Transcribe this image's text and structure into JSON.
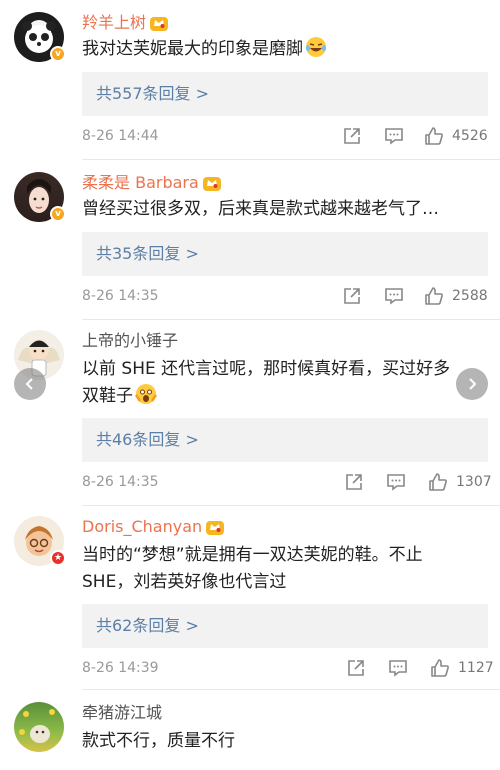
{
  "comments": [
    {
      "username": "羚羊上树",
      "text": "我对达芙妮最大的印象是磨脚",
      "replies_label": "共557条回复 >",
      "time": "8-26 14:44",
      "likes": "4526"
    },
    {
      "username": "柔柔是 Barbara",
      "text": "曾经买过很多双，后来真是款式越来越老气了…",
      "replies_label": "共35条回复 >",
      "time": "8-26 14:35",
      "likes": "2588"
    },
    {
      "username": "上帝的小锤子",
      "text_line1": "以前 SHE 还代言过呢，那时候真好看，买过好多",
      "text_line2": "双鞋子",
      "replies_label": "共46条回复 >",
      "time": "8-26 14:35",
      "likes": "1307"
    },
    {
      "username": "Doris_Chanyan",
      "text_line1": "当时的“梦想”就是拥有一双达芙妮的鞋。不止",
      "text_line2": "SHE，刘若英好像也代言过",
      "replies_label": "共62条回复 >",
      "time": "8-26 14:39",
      "likes": "1127"
    },
    {
      "username": "牵猪游江城",
      "text": "款式不行，质量不行"
    }
  ],
  "nav": {
    "prev_icon": "chevron-left-icon",
    "next_icon": "chevron-right-icon"
  },
  "colors": {
    "vip_name": "#eb7350",
    "reply_link": "#5b7fa6",
    "reply_bg": "#f2f2f2",
    "badge_orange": "#f5a623"
  }
}
